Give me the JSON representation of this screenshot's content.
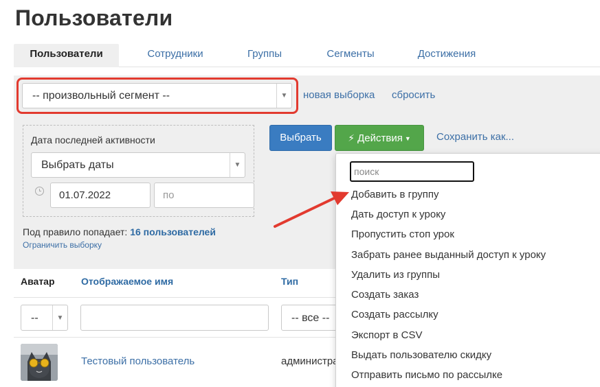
{
  "page": {
    "title": "Пользователи"
  },
  "tabs": [
    {
      "label": "Пользователи",
      "active": true
    },
    {
      "label": "Сотрудники",
      "active": false
    },
    {
      "label": "Группы",
      "active": false
    },
    {
      "label": "Сегменты",
      "active": false
    },
    {
      "label": "Достижения",
      "active": false
    }
  ],
  "segment": {
    "selected": "-- произвольный сегмент --",
    "new_selection": "новая выборка",
    "reset": "сбросить"
  },
  "filter": {
    "date_label": "Дата последней активности",
    "date_select": "Выбрать даты",
    "date_from": "01.07.2022",
    "date_to_placeholder": "по",
    "rule_prefix": "Под правило попадает:",
    "rule_count": "16 пользователей",
    "limit_link": "Ограничить выборку"
  },
  "toolbar": {
    "select_button": "Выбрать",
    "actions_button": "Действия",
    "save_as": "Сохранить как..."
  },
  "actions_menu": {
    "search_placeholder": "поиск",
    "items": [
      "Добавить в группу",
      "Дать доступ к уроку",
      "Пропустить стоп урок",
      "Забрать ранее выданный доступ к уроку",
      "Удалить из группы",
      "Создать заказ",
      "Создать рассылку",
      "Экспорт в CSV",
      "Выдать пользователю скидку",
      "Отправить письмо по рассылке"
    ]
  },
  "table": {
    "headers": {
      "avatar": "Аватар",
      "name": "Отображаемое имя",
      "type": "Тип"
    },
    "filters": {
      "avatar": "--",
      "type": "-- все --"
    },
    "rows": [
      {
        "name": "Тестовый пользователь",
        "type": "администра"
      }
    ]
  },
  "colors": {
    "accent_blue": "#3a7cc1",
    "accent_green": "#53a64a",
    "highlight_red": "#e23a2f",
    "link_blue": "#3c6fa6"
  }
}
